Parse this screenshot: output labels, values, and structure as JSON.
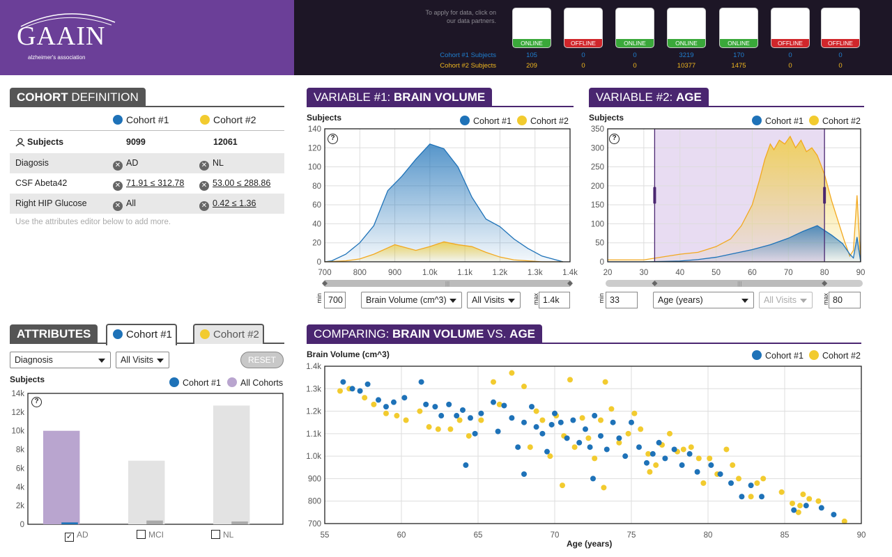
{
  "header": {
    "logo_main": "GAAIN",
    "logo_sub": "alzheimer's association",
    "apply_text": "To apply for data, click on our data partners.",
    "partners": [
      {
        "status": "ONLINE",
        "c1": "105",
        "c2": "209"
      },
      {
        "status": "OFFLINE",
        "c1": "0",
        "c2": "0"
      },
      {
        "status": "ONLINE",
        "c1": "0",
        "c2": "0"
      },
      {
        "status": "ONLINE",
        "c1": "3219",
        "c2": "10377"
      },
      {
        "status": "ONLINE",
        "c1": "170",
        "c2": "1475"
      },
      {
        "status": "OFFLINE",
        "c1": "0",
        "c2": "0"
      },
      {
        "status": "OFFLINE",
        "c1": "0",
        "c2": "0"
      }
    ],
    "row1_label": "Cohort #1 Subjects",
    "row2_label": "Cohort #2 Subjects"
  },
  "cohort_def": {
    "title_bold": "COHORT",
    "title_rest": " DEFINITION",
    "col1": "Cohort #1",
    "col2": "Cohort #2",
    "rows": [
      {
        "label": "Subjects",
        "v1": "9099",
        "v2": "12061"
      },
      {
        "label": "Diagosis",
        "v1": "AD",
        "v2": "NL"
      },
      {
        "label": "CSF Abeta42",
        "v1": "71.91 ≤ 312.78",
        "v2": "53.00 ≤ 288.86"
      },
      {
        "label": "Right HIP Glucose",
        "v1": "All",
        "v2": "0.42 ≤ 1.36"
      }
    ],
    "hint": "Use the attributes editor below to add more."
  },
  "attributes": {
    "title": "ATTRIBUTES",
    "tab1": "Cohort #1",
    "tab2": "Cohort #2",
    "select1": "Diagnosis",
    "select2": "All Visits",
    "reset": "RESET",
    "ylabel": "Subjects",
    "legend1": "Cohort #1",
    "legend2": "All Cohorts",
    "checks": [
      {
        "label": "AD",
        "checked": true
      },
      {
        "label": "MCI",
        "checked": false
      },
      {
        "label": "NL",
        "checked": false
      }
    ]
  },
  "var1": {
    "title_pre": "VARIABLE #1: ",
    "title_bold": "BRAIN VOLUME",
    "ylabel": "Subjects",
    "legend1": "Cohort #1",
    "legend2": "Cohort #2",
    "min_label": "min",
    "max_label": "max",
    "min_value": "700",
    "max_value": "1.4k",
    "select_var": "Brain Volume (cm^3)",
    "select_visits": "All Visits"
  },
  "var2": {
    "title_pre": "VARIABLE #2: ",
    "title_bold": "AGE",
    "ylabel": "Subjects",
    "legend1": "Cohort #1",
    "legend2": "Cohort #2",
    "min_label": "min",
    "max_label": "max",
    "min_value": "33",
    "max_value": "80",
    "select_var": "Age (years)",
    "select_visits": "All Visits"
  },
  "compare": {
    "title_pre": "COMPARING: ",
    "title_b1": "BRAIN VOLUME",
    "title_mid": " VS. ",
    "title_b2": "AGE",
    "ylabel": "Brain Volume (cm^3)",
    "xlabel": "Age (years)",
    "legend1": "Cohort #1",
    "legend2": "Cohort #2"
  },
  "chart_data": [
    {
      "type": "bar",
      "title": "Attributes: Diagnosis",
      "categories": [
        "AD",
        "MCI",
        "NL"
      ],
      "ylabel": "Subjects",
      "ylim": [
        0,
        14000
      ],
      "yticks": [
        "0",
        "2k",
        "4k",
        "6k",
        "8k",
        "10k",
        "12k",
        "14k"
      ],
      "series": [
        {
          "name": "All Cohorts",
          "values": [
            10000,
            6800,
            12700
          ],
          "colors": [
            "#b9a5cf",
            "#e3e3e3",
            "#e3e3e3"
          ]
        },
        {
          "name": "Cohort #1",
          "values": [
            200,
            400,
            300
          ],
          "colors": [
            "#1e72b8",
            "#aaaaaa",
            "#aaaaaa"
          ]
        }
      ]
    },
    {
      "type": "area",
      "xlim": [
        700,
        1400
      ],
      "ylim": [
        0,
        140
      ],
      "xticks": [
        700,
        800,
        900,
        1000,
        1100,
        1200,
        1300,
        1400
      ],
      "xtick_labels": [
        "700",
        "800",
        "900",
        "1.0k",
        "1.1k",
        "1.2k",
        "1.3k",
        "1.4k"
      ],
      "yticks": [
        0,
        20,
        40,
        60,
        80,
        100,
        120,
        140
      ],
      "series": [
        {
          "name": "Cohort #1",
          "x": [
            700,
            720,
            760,
            800,
            840,
            880,
            920,
            960,
            1000,
            1040,
            1080,
            1120,
            1160,
            1200,
            1240,
            1280,
            1320,
            1360,
            1380
          ],
          "y": [
            0,
            1,
            8,
            20,
            38,
            75,
            90,
            108,
            124,
            119,
            100,
            68,
            45,
            37,
            24,
            14,
            6,
            2,
            0
          ]
        },
        {
          "name": "Cohort #2",
          "x": [
            700,
            760,
            800,
            840,
            900,
            960,
            1000,
            1040,
            1080,
            1120,
            1160,
            1200,
            1240,
            1280,
            1320,
            1380
          ],
          "y": [
            0,
            1,
            3,
            8,
            18,
            12,
            16,
            21,
            18,
            16,
            10,
            5,
            2,
            1,
            0,
            0
          ]
        }
      ]
    },
    {
      "type": "area",
      "xlim": [
        20,
        90
      ],
      "ylim": [
        0,
        350
      ],
      "xticks": [
        20,
        30,
        40,
        50,
        60,
        70,
        80,
        90
      ],
      "yticks": [
        0,
        50,
        100,
        150,
        200,
        250,
        300,
        350
      ],
      "selection": [
        33,
        80
      ],
      "series": [
        {
          "name": "Cohort #1",
          "x": [
            20,
            30,
            40,
            45,
            50,
            55,
            60,
            65,
            70,
            74,
            78,
            82,
            85,
            87,
            88,
            89,
            90
          ],
          "y": [
            0,
            0,
            2,
            6,
            12,
            22,
            32,
            45,
            62,
            80,
            95,
            70,
            48,
            20,
            10,
            65,
            0
          ]
        },
        {
          "name": "Cohort #2",
          "x": [
            20,
            30,
            40,
            45,
            50,
            54,
            57,
            60,
            62,
            63.5,
            65,
            66,
            67.5,
            69,
            70.5,
            72,
            73.5,
            75,
            76.5,
            78,
            80,
            82,
            84,
            85.5,
            87,
            88,
            89,
            90
          ],
          "y": [
            5,
            5,
            20,
            25,
            40,
            60,
            95,
            150,
            215,
            270,
            310,
            295,
            320,
            310,
            330,
            300,
            320,
            290,
            300,
            280,
            230,
            160,
            100,
            55,
            15,
            30,
            175,
            0
          ]
        }
      ]
    },
    {
      "type": "scatter",
      "xlabel": "Age (years)",
      "ylabel": "Brain Volume (cm^3)",
      "xlim": [
        55,
        90
      ],
      "ylim": [
        700,
        1400
      ],
      "xticks": [
        55,
        60,
        65,
        70,
        75,
        80,
        85,
        90
      ],
      "yticks": [
        700,
        800,
        900,
        1000,
        1100,
        1200,
        1300,
        1400
      ],
      "ytick_labels": [
        "700",
        "800",
        "900",
        "1.0k",
        "1.1k",
        "1.2k",
        "1.3k",
        "1.4k"
      ],
      "series": [
        {
          "name": "Cohort #1",
          "points": [
            [
              56.2,
              1330
            ],
            [
              56.8,
              1300
            ],
            [
              57.3,
              1290
            ],
            [
              57.8,
              1320
            ],
            [
              58.5,
              1250
            ],
            [
              59,
              1220
            ],
            [
              59.5,
              1240
            ],
            [
              60.2,
              1260
            ],
            [
              61.3,
              1330
            ],
            [
              61.6,
              1230
            ],
            [
              62.2,
              1220
            ],
            [
              62.6,
              1180
            ],
            [
              63.1,
              1230
            ],
            [
              63.6,
              1180
            ],
            [
              64,
              1205
            ],
            [
              64.5,
              1170
            ],
            [
              64.8,
              1100
            ],
            [
              65.2,
              1190
            ],
            [
              66,
              1240
            ],
            [
              66.3,
              1110
            ],
            [
              66.7,
              1225
            ],
            [
              67.2,
              1170
            ],
            [
              67.6,
              1040
            ],
            [
              68,
              1150
            ],
            [
              68.5,
              1220
            ],
            [
              68.8,
              1130
            ],
            [
              69.2,
              1100
            ],
            [
              69.5,
              1020
            ],
            [
              69.8,
              1140
            ],
            [
              70,
              1190
            ],
            [
              70.4,
              1150
            ],
            [
              70.8,
              1080
            ],
            [
              71.2,
              1160
            ],
            [
              71.6,
              1060
            ],
            [
              72,
              1120
            ],
            [
              72.3,
              1040
            ],
            [
              72.6,
              1180
            ],
            [
              73,
              1090
            ],
            [
              73.4,
              1030
            ],
            [
              73.8,
              1150
            ],
            [
              74.2,
              1080
            ],
            [
              74.6,
              1000
            ],
            [
              75,
              1150
            ],
            [
              75.5,
              1040
            ],
            [
              76,
              970
            ],
            [
              76.4,
              1010
            ],
            [
              76.8,
              1060
            ],
            [
              77.2,
              990
            ],
            [
              77.8,
              1030
            ],
            [
              78.3,
              960
            ],
            [
              78.8,
              1010
            ],
            [
              79.3,
              930
            ],
            [
              80.2,
              960
            ],
            [
              80.8,
              920
            ],
            [
              81.5,
              880
            ],
            [
              82.2,
              820
            ],
            [
              82.8,
              870
            ],
            [
              83.5,
              820
            ],
            [
              85.6,
              760
            ],
            [
              86.4,
              780
            ],
            [
              87.4,
              770
            ],
            [
              88.2,
              740
            ],
            [
              64.2,
              960
            ],
            [
              68,
              920
            ],
            [
              72.5,
              900
            ]
          ]
        },
        {
          "name": "Cohort #2",
          "points": [
            [
              56,
              1290
            ],
            [
              56.6,
              1300
            ],
            [
              57.6,
              1260
            ],
            [
              58.2,
              1230
            ],
            [
              59,
              1190
            ],
            [
              59.7,
              1180
            ],
            [
              60.3,
              1160
            ],
            [
              61.2,
              1200
            ],
            [
              61.8,
              1130
            ],
            [
              62.4,
              1120
            ],
            [
              63.2,
              1120
            ],
            [
              63.8,
              1160
            ],
            [
              64.4,
              1090
            ],
            [
              65.2,
              1160
            ],
            [
              66,
              1330
            ],
            [
              66.4,
              1230
            ],
            [
              67.2,
              1370
            ],
            [
              68,
              1310
            ],
            [
              68.4,
              1040
            ],
            [
              68.8,
              1200
            ],
            [
              69.2,
              1160
            ],
            [
              69.7,
              1000
            ],
            [
              70.1,
              1180
            ],
            [
              70.6,
              1090
            ],
            [
              71,
              1340
            ],
            [
              71.3,
              1040
            ],
            [
              71.8,
              1170
            ],
            [
              72.2,
              1080
            ],
            [
              72.6,
              990
            ],
            [
              73,
              1160
            ],
            [
              73.3,
              1330
            ],
            [
              73.7,
              1210
            ],
            [
              74.2,
              1060
            ],
            [
              74.8,
              1100
            ],
            [
              75.2,
              1190
            ],
            [
              75.6,
              1120
            ],
            [
              76.1,
              1010
            ],
            [
              76.6,
              960
            ],
            [
              77,
              1050
            ],
            [
              77.5,
              1100
            ],
            [
              78,
              1020
            ],
            [
              78.4,
              1030
            ],
            [
              78.9,
              1040
            ],
            [
              79.4,
              990
            ],
            [
              80.1,
              990
            ],
            [
              80.6,
              920
            ],
            [
              81.2,
              1030
            ],
            [
              81.6,
              960
            ],
            [
              82,
              900
            ],
            [
              82.8,
              820
            ],
            [
              83.6,
              900
            ],
            [
              84.8,
              840
            ],
            [
              85.5,
              790
            ],
            [
              86,
              780
            ],
            [
              86.6,
              810
            ],
            [
              87.2,
              800
            ],
            [
              88.9,
              710
            ],
            [
              85.9,
              750
            ],
            [
              86.2,
              830
            ],
            [
              70.5,
              870
            ],
            [
              73.2,
              860
            ],
            [
              76.2,
              930
            ],
            [
              79.7,
              880
            ],
            [
              83.2,
              880
            ]
          ]
        }
      ]
    }
  ],
  "colors": {
    "blue": "#1e72b8",
    "yellow": "#f2cb2f",
    "purple": "#4a2670",
    "lavender": "#b9a5cf"
  }
}
